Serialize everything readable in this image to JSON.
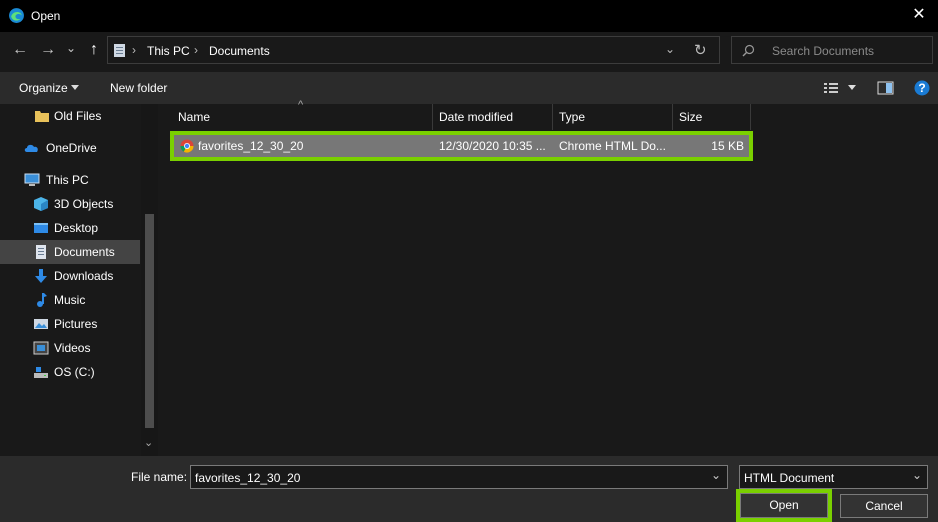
{
  "window": {
    "title": "Open",
    "close_glyph": "✕"
  },
  "nav": {
    "back_glyph": "←",
    "forward_glyph": "→",
    "recent_glyph": "⌄",
    "up_glyph": "↑",
    "refresh_glyph": "↻",
    "path_sep": "›",
    "breadcrumb": [
      "This PC",
      "Documents"
    ]
  },
  "search": {
    "placeholder": "Search Documents"
  },
  "toolbar": {
    "organize_label": "Organize",
    "new_folder_label": "New folder",
    "help_glyph": "?"
  },
  "sidebar": {
    "items": [
      {
        "label": "Old Files",
        "icon": "folder-icon"
      },
      {
        "label": "OneDrive",
        "icon": "cloud-icon"
      },
      {
        "label": "This PC",
        "icon": "computer-icon"
      },
      {
        "label": "3D Objects",
        "icon": "cube-icon"
      },
      {
        "label": "Desktop",
        "icon": "desktop-icon"
      },
      {
        "label": "Documents",
        "icon": "document-icon"
      },
      {
        "label": "Downloads",
        "icon": "download-icon"
      },
      {
        "label": "Music",
        "icon": "music-icon"
      },
      {
        "label": "Pictures",
        "icon": "picture-icon"
      },
      {
        "label": "Videos",
        "icon": "video-icon"
      },
      {
        "label": "OS (C:)",
        "icon": "drive-icon"
      }
    ],
    "scroll_down_glyph": "⌄"
  },
  "columns": {
    "name": "Name",
    "date": "Date modified",
    "type": "Type",
    "size": "Size",
    "sort_glyph": "^"
  },
  "files": [
    {
      "name": "favorites_12_30_20",
      "date": "12/30/2020 10:35 ...",
      "type": "Chrome HTML Do...",
      "size": "15 KB"
    }
  ],
  "footer": {
    "file_name_label": "File name:",
    "file_name_value": "favorites_12_30_20",
    "file_type_value": "HTML Document",
    "dropdown_glyph": "⌄",
    "open_label": "Open",
    "cancel_label": "Cancel"
  },
  "colors": {
    "highlight": "#7ad000",
    "selected_row": "#777777",
    "dialog_bg": "#191919"
  }
}
